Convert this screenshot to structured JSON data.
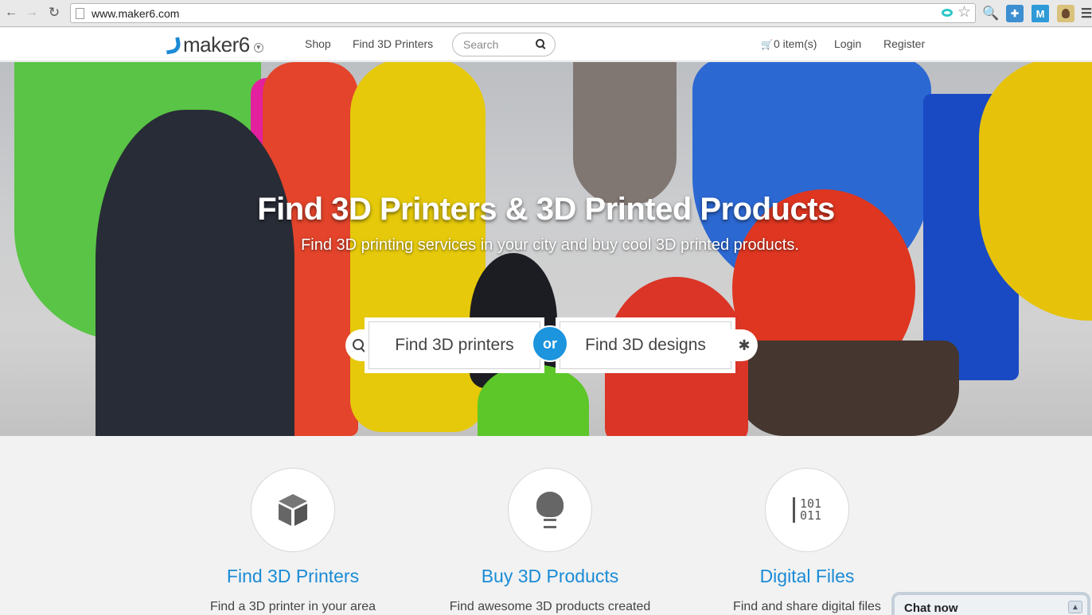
{
  "browser": {
    "url": "www.maker6.com",
    "ext_m_label": "M"
  },
  "header": {
    "logo_text": "maker6",
    "nav": {
      "shop": "Shop",
      "find_printers": "Find 3D Printers"
    },
    "search": {
      "placeholder": "Search"
    },
    "cart": "0 item(s)",
    "login": "Login",
    "register": "Register"
  },
  "hero": {
    "title": "Find 3D Printers & 3D Printed Products",
    "subtitle": "Find 3D printing services in your city and buy cool 3D printed products.",
    "cta_printers": "Find 3D printers",
    "cta_or": "or",
    "cta_designs": "Find 3D designs"
  },
  "features": [
    {
      "title": "Find 3D Printers",
      "desc": "Find a 3D printer in your area",
      "icon": "cube-icon"
    },
    {
      "title": "Buy 3D Products",
      "desc": "Find awesome 3D products created",
      "icon": "lightbulb-icon"
    },
    {
      "title": "Digital Files",
      "desc": "Find and share digital files",
      "icon": "binary-icon",
      "binary_top": "101",
      "binary_bottom": "011"
    }
  ],
  "chat": {
    "label": "Chat now"
  },
  "colors": {
    "accent": "#1a8bd6",
    "or_badge": "#1c94de"
  }
}
